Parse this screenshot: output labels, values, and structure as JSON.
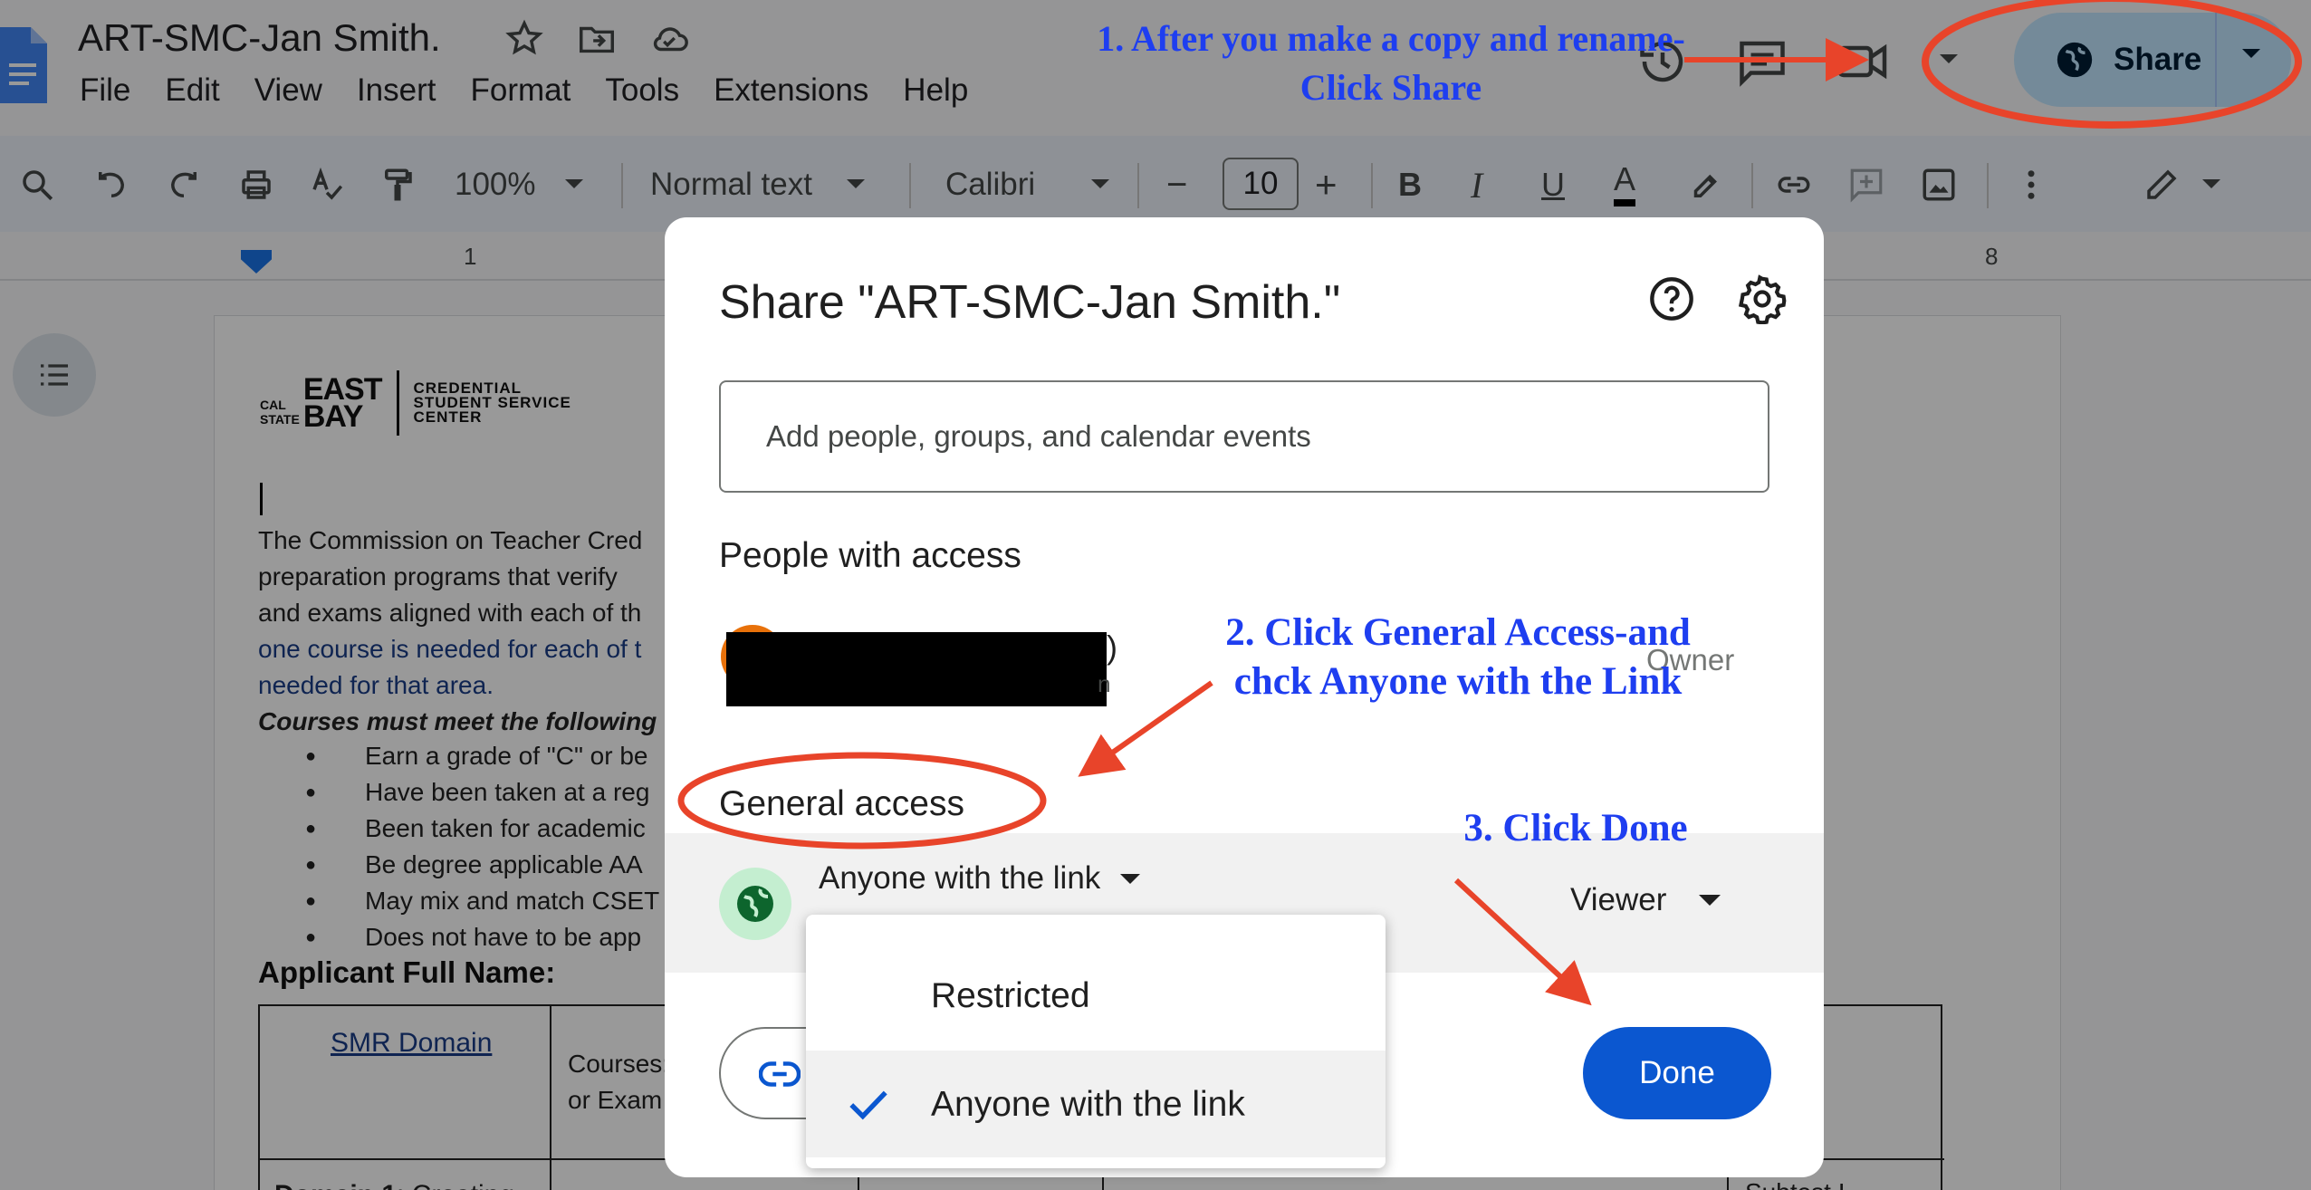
{
  "app": {
    "doc_title": "ART-SMC-Jan Smith.",
    "menu": [
      "File",
      "Edit",
      "View",
      "Insert",
      "Format",
      "Tools",
      "Extensions",
      "Help"
    ],
    "share_label": "Share"
  },
  "toolbar": {
    "zoom": "100%",
    "style": "Normal text",
    "font": "Calibri",
    "font_size": "10",
    "minus": "−",
    "plus": "+",
    "bold": "B",
    "italic": "I",
    "underline": "U",
    "text_color": "A"
  },
  "ruler": {
    "mark_1": "1",
    "mark_8": "8"
  },
  "document": {
    "logo_cal": "CAL",
    "logo_state": "STATE",
    "logo_east": "EAST",
    "logo_bay": "BAY",
    "logo_line1": "CREDENTIAL",
    "logo_line2": "STUDENT SERVICE",
    "logo_line3": "CENTER",
    "para_line1": "The Commission on Teacher Cred",
    "para_line2": "preparation programs that verify",
    "para_line3": "and exams aligned with each of th",
    "para_line4": "one course is needed for each of t",
    "para_line5": "needed for that area.",
    "courses_heading": "Courses must meet the following",
    "bullets": [
      "Earn a grade of \"C\" or be",
      "Have been taken at a reg",
      "Been taken for academic",
      "Be degree applicable AA",
      "May mix and match CSET",
      "Does not have to be app"
    ],
    "applicant_label": "Applicant Full Name:",
    "table_smr": "SMR Domain",
    "table_courses_1": "Courses:",
    "table_courses_2": "or Exam",
    "table_domain1_bold": "Domain 1",
    "table_domain1_rest": ": Creating",
    "table_subtest": "Subtest I"
  },
  "dialog": {
    "title": "Share \"ART-SMC-Jan Smith.\"",
    "add_placeholder": "Add people, groups, and calendar events",
    "people_heading": "People with access",
    "person_suffix": ")",
    "person_email_tail": "n",
    "owner_label": "Owner",
    "general_access_heading": "General access",
    "access_value": "Anyone with the link",
    "role_value": "Viewer",
    "done_label": "Done"
  },
  "menu": {
    "items": [
      {
        "label": "Restricted",
        "selected": false
      },
      {
        "label": "Anyone with the link",
        "selected": true
      }
    ]
  },
  "annotations": {
    "note1_line1": "1. After you make a copy and rename-",
    "note1_line2": "Click Share",
    "note2_line1": "2. Click General Access-and",
    "note2_line2": "chck Anyone with the Link",
    "note3": "3. Click Done"
  },
  "colors": {
    "accent": "#0b57d0",
    "share_bg": "#c2e7ff",
    "annotation_red": "#e8442a",
    "annotation_blue": "#1e3ef0"
  }
}
